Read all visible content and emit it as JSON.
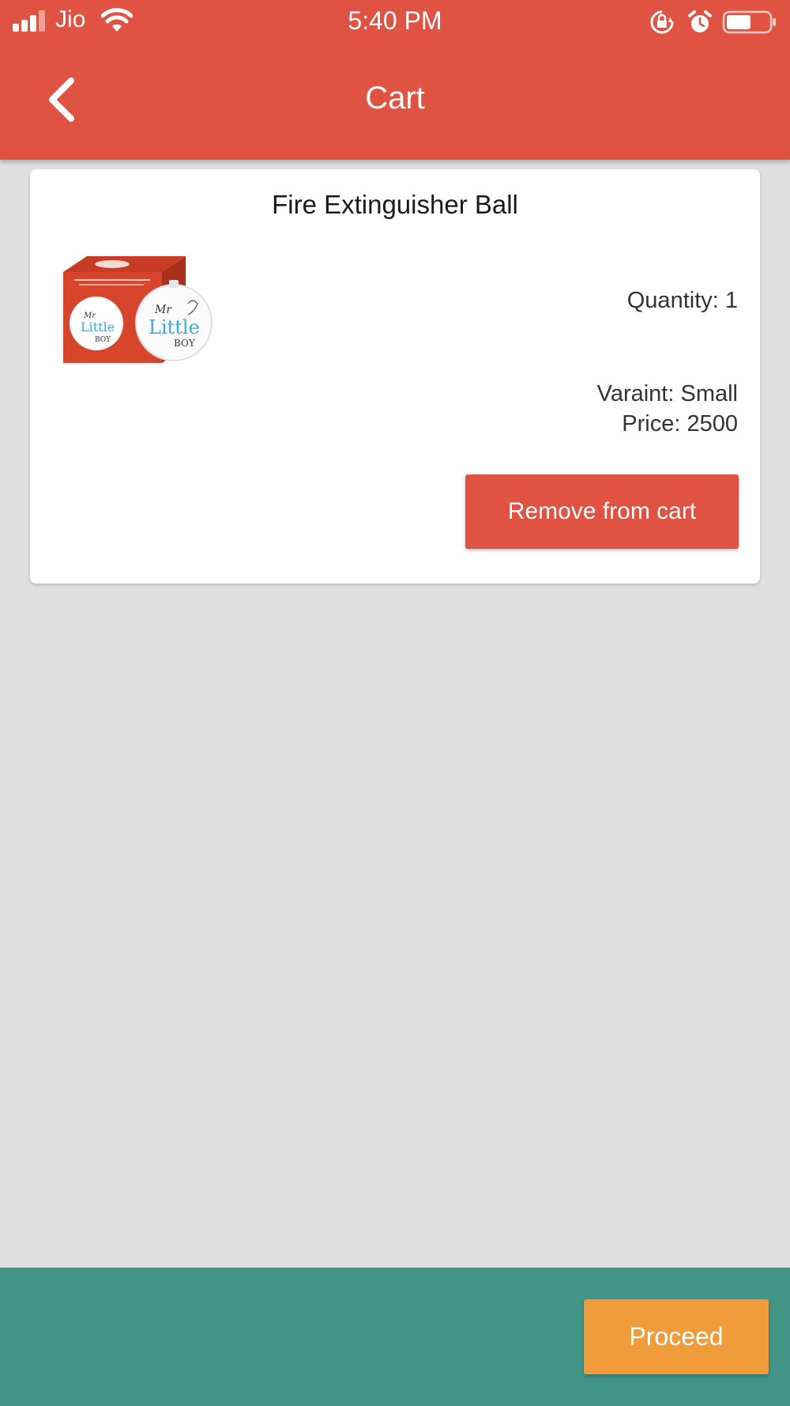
{
  "status_bar": {
    "carrier": "Jio",
    "time": "5:40 PM",
    "icons": [
      "signal-icon",
      "wifi-icon",
      "rotation-lock-icon",
      "alarm-icon",
      "battery-icon"
    ],
    "battery_level": 0.55
  },
  "header": {
    "title": "Cart",
    "back_icon": "chevron-left-icon",
    "background_color": "#e05241"
  },
  "cart": {
    "items": [
      {
        "name": "Fire Extinguisher Ball",
        "image_brand_text": "Mr Little BOY",
        "quantity_text": "Quantity: 1",
        "variant_text": "Varaint: Small",
        "price_text": "Price: 2500",
        "remove_label": "Remove from cart"
      }
    ]
  },
  "footer": {
    "proceed_label": "Proceed",
    "background_color": "#439587",
    "button_color": "#f09c3b"
  }
}
